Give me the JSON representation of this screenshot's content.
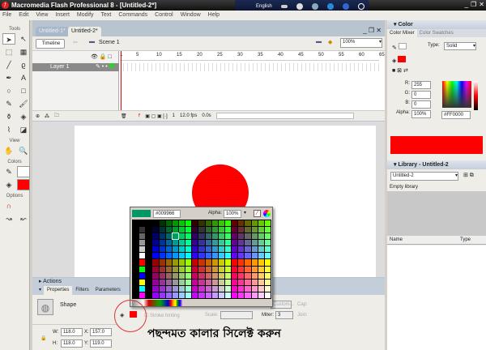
{
  "title": "Macromedia Flash Professional 8 - [Untitled-2*]",
  "langbar": {
    "language": "English"
  },
  "menu": [
    "File",
    "Edit",
    "View",
    "Insert",
    "Modify",
    "Text",
    "Commands",
    "Control",
    "Window",
    "Help"
  ],
  "tools": {
    "title": "Tools",
    "view": "View",
    "colors": "Colors",
    "options": "Options"
  },
  "doc": {
    "tabs": [
      "Untitled-1*",
      "Untitled-2*"
    ],
    "timeline_btn": "Timeline",
    "scene": "Scene 1",
    "zoom": "100%",
    "ruler": [
      "1",
      "5",
      "10",
      "15",
      "20",
      "25",
      "30",
      "35",
      "40",
      "45",
      "50",
      "55",
      "60",
      "65"
    ],
    "layer": "Layer 1",
    "frame": "1",
    "fps": "12.0 fps",
    "time": "0.0s"
  },
  "color_panel": {
    "title": "Color",
    "tabs": [
      "Color Mixer",
      "Color Swatches"
    ],
    "type_label": "Type:",
    "type": "Solid",
    "r_label": "R:",
    "r": "255",
    "g_label": "G:",
    "g": "0",
    "b_label": "B:",
    "b": "0",
    "alpha_label": "Alpha:",
    "alpha": "100%",
    "hex": "#FF0000",
    "fill": "#ff0000"
  },
  "library": {
    "title": "Library - Untitled-2",
    "doc": "Untitled-2",
    "empty": "Empty library",
    "col_name": "Name",
    "col_type": "Type"
  },
  "bottom": {
    "actions": "Actions",
    "tabs": [
      "Properties",
      "Filters",
      "Parameters"
    ],
    "shape": "Shape",
    "stroke_hinting": "Stroke hinting",
    "scale": "Scale:",
    "miter_label": "Miter:",
    "miter": "3",
    "custom": "Custom...",
    "cap": "Cap:",
    "join": "Join:",
    "w_label": "W:",
    "w": "118.0",
    "x_label": "X:",
    "x": "157.0",
    "h_label": "H:",
    "h": "118.0",
    "y_label": "Y:",
    "y": "119.0"
  },
  "picker": {
    "hex": "#009966",
    "alpha_label": "Alpha:",
    "alpha": "100%",
    "preview": "#009966"
  },
  "annotation": "পছন্দমত কালার সিলেক্ট করুন"
}
